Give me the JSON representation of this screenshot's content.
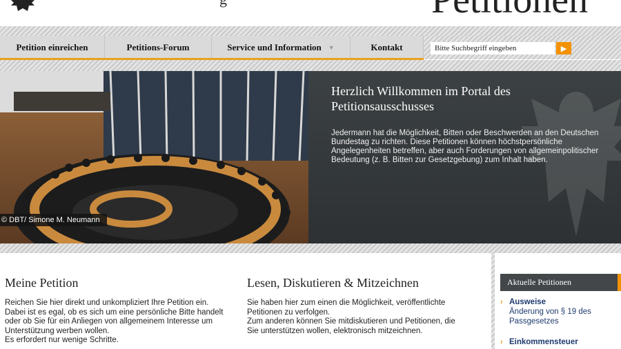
{
  "header": {
    "site_name": "g",
    "title": "Petitionen"
  },
  "nav": {
    "items": [
      {
        "label": "Petition einreichen"
      },
      {
        "label": "Petitions-Forum"
      },
      {
        "label": "Service und Information"
      },
      {
        "label": "Kontakt"
      }
    ],
    "search_placeholder": "Bitte Suchbegriff eingeben"
  },
  "hero": {
    "image_credit": "© DBT/ Simone M. Neumann",
    "title": "Herzlich Willkommen im Portal des Petitionsausschusses",
    "text": "Jedermann hat die Möglichkeit, Bitten oder Beschwerden an den Deutschen Bundestag zu richten. Diese Petitionen können höchstpersönliche Angelegenheiten betreffen, aber auch Forderungen von allgemeinpolitischer Bedeutung (z. B. Bitten zur Gesetzgebung) zum Inhalt haben."
  },
  "meine_petition": {
    "title": "Meine Petition",
    "text1": "Reichen Sie hier direkt und unkompliziert Ihre Petition ein. Dabei ist es egal, ob es sich um eine persönliche Bitte handelt oder ob Sie für ein Anliegen von allgemeinem Interesse um Unterstützung werben wollen.",
    "text2": "Es erfordert nur wenige Schritte."
  },
  "lesen": {
    "title": "Lesen, Diskutieren & Mitzeichnen",
    "text1": "Sie haben hier zum einen die Möglichkeit, veröffentlichte Petitionen zu verfolgen.",
    "text2": "Zum anderen können Sie mitdiskutieren und Petitionen, die Sie unterstützen wollen, elektronisch mitzeichnen."
  },
  "sidebar": {
    "title": "Aktuelle Petitionen",
    "items": [
      {
        "title": "Ausweise",
        "subtitle": "Änderung von § 19 des Passgesetzes"
      },
      {
        "title": "Einkommensteuer",
        "subtitle": ""
      }
    ]
  }
}
